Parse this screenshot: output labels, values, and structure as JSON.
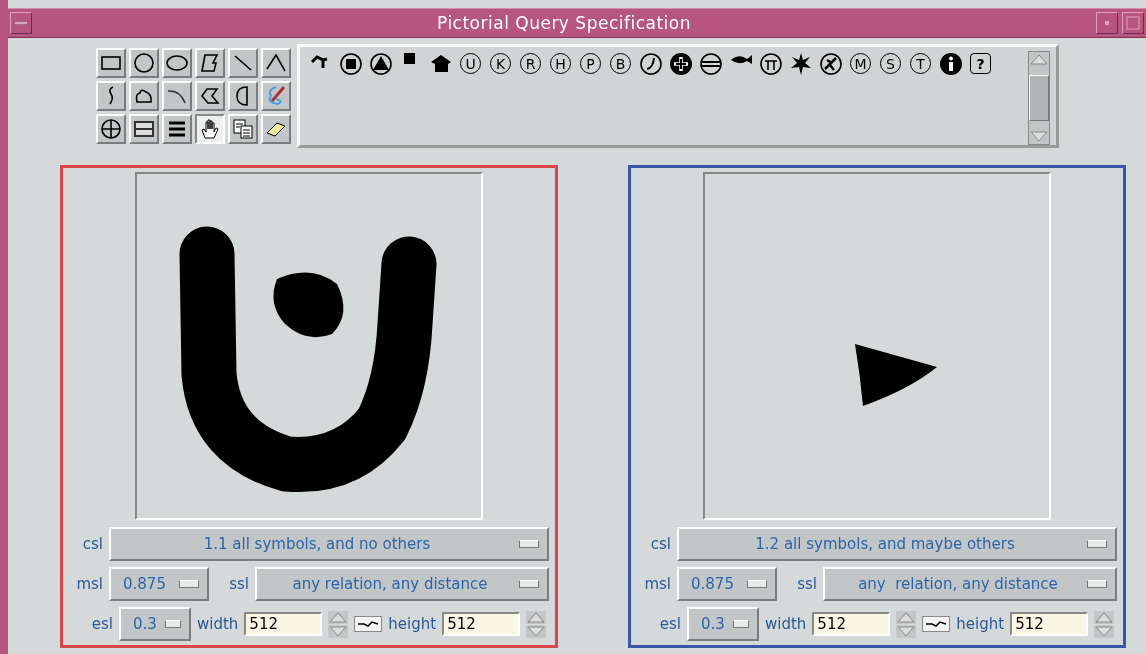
{
  "window": {
    "title": "Pictorial Query Specification"
  },
  "tools": [
    {
      "kind": "rectangle",
      "selected": false
    },
    {
      "kind": "circle",
      "selected": false
    },
    {
      "kind": "ellipse",
      "selected": false
    },
    {
      "kind": "polygon",
      "selected": false
    },
    {
      "kind": "line",
      "selected": false
    },
    {
      "kind": "angle",
      "selected": false
    },
    {
      "kind": "squiggle",
      "selected": false
    },
    {
      "kind": "blob",
      "selected": false
    },
    {
      "kind": "arc",
      "selected": false
    },
    {
      "kind": "notch",
      "selected": false
    },
    {
      "kind": "halfdisc",
      "selected": false
    },
    {
      "kind": "lasso",
      "selected": false
    },
    {
      "kind": "crosshair",
      "selected": false
    },
    {
      "kind": "textbox",
      "selected": false
    },
    {
      "kind": "lines",
      "selected": false
    },
    {
      "kind": "hand",
      "selected": true
    },
    {
      "kind": "copy",
      "selected": false
    },
    {
      "kind": "eraser",
      "selected": false
    }
  ],
  "symbols": [
    {
      "kind": "hook"
    },
    {
      "kind": "ringsquare"
    },
    {
      "kind": "ringtriangle"
    },
    {
      "kind": "square"
    },
    {
      "kind": "house"
    },
    {
      "kind": "letter",
      "label": "U"
    },
    {
      "kind": "letter",
      "label": "K"
    },
    {
      "kind": "letter",
      "label": "R"
    },
    {
      "kind": "letter",
      "label": "H"
    },
    {
      "kind": "letter",
      "label": "P"
    },
    {
      "kind": "letter",
      "label": "B"
    },
    {
      "kind": "phone"
    },
    {
      "kind": "cross"
    },
    {
      "kind": "bars"
    },
    {
      "kind": "fish"
    },
    {
      "kind": "gate"
    },
    {
      "kind": "star"
    },
    {
      "kind": "plane"
    },
    {
      "kind": "letter",
      "label": "M"
    },
    {
      "kind": "letter",
      "label": "S"
    },
    {
      "kind": "letter",
      "label": "T"
    },
    {
      "kind": "info"
    },
    {
      "kind": "boxed",
      "label": "?"
    }
  ],
  "panels": [
    {
      "color": "#d84848",
      "kind": "cup",
      "csl": {
        "label": "csl",
        "value": "1.1 all symbols, and no others"
      },
      "msl": {
        "label": "msl",
        "value": "0.875"
      },
      "ssl": {
        "label": "ssl",
        "value": "any relation, any distance"
      },
      "esl": {
        "label": "esl",
        "value": "0.3"
      },
      "width": {
        "label": "width",
        "value": "512"
      },
      "height": {
        "label": "height",
        "value": "512"
      }
    },
    {
      "color": "#3a56a8",
      "kind": "wedge",
      "csl": {
        "label": "csl",
        "value": "1.2 all symbols, and maybe others"
      },
      "msl": {
        "label": "msl",
        "value": "0.875"
      },
      "ssl": {
        "label": "ssl",
        "value": "any  relation, any distance"
      },
      "esl": {
        "label": "esl",
        "value": "0.3"
      },
      "width": {
        "label": "width",
        "value": "512"
      },
      "height": {
        "label": "height",
        "value": "512"
      }
    }
  ]
}
